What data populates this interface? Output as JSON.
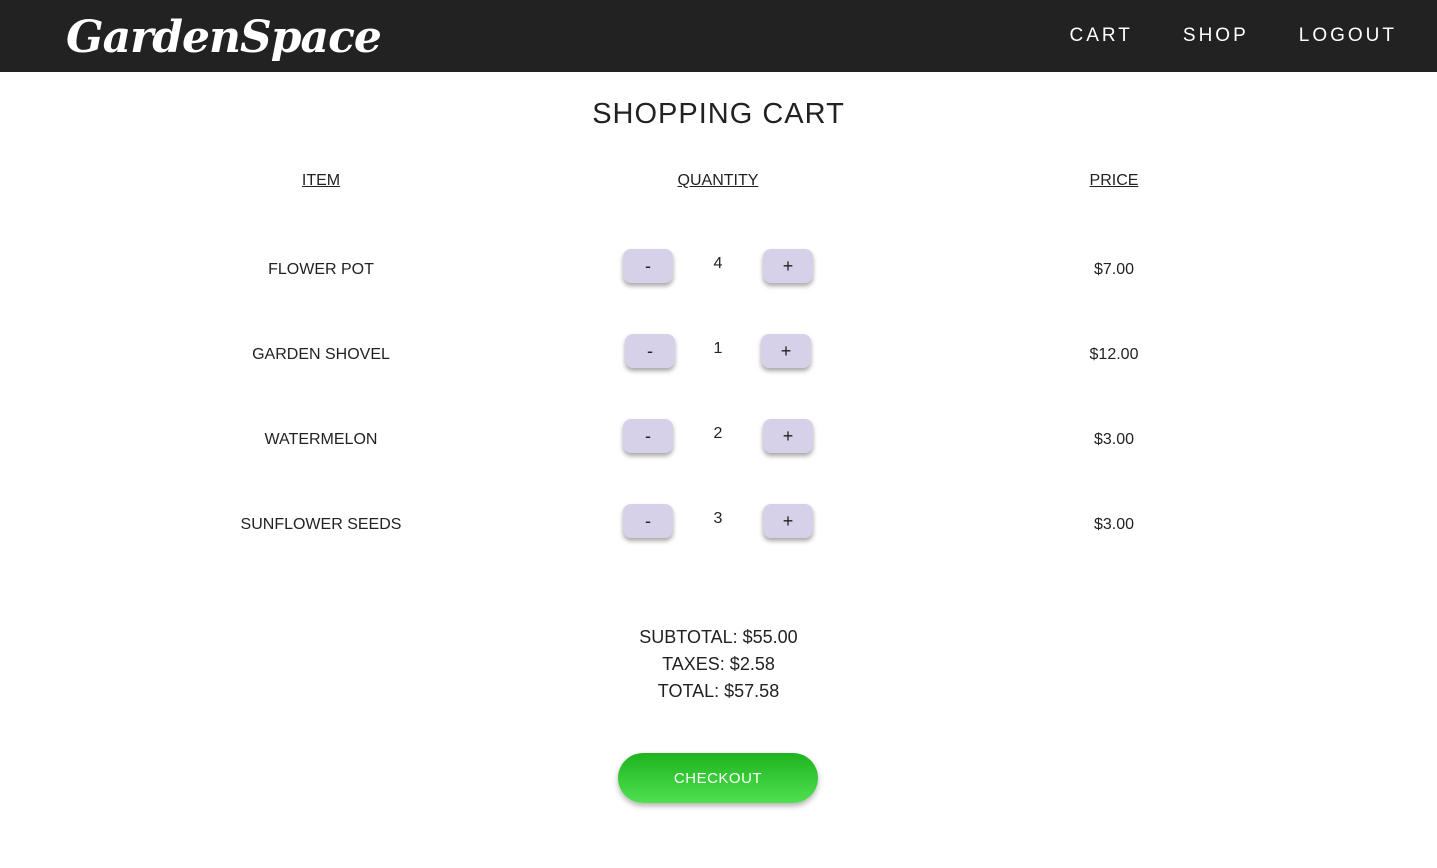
{
  "navbar": {
    "logo": "GardenSpace",
    "links": [
      "CART",
      "SHOP",
      "LOGOUT"
    ]
  },
  "page_title": "SHOPPING CART",
  "columns": {
    "item": "ITEM",
    "quantity": "QUANTITY",
    "price": "PRICE"
  },
  "rows": [
    {
      "item": "FLOWER POT",
      "quantity": "4",
      "price": "$7.00"
    },
    {
      "item": "GARDEN SHOVEL",
      "quantity": "1",
      "price": "$12.00"
    },
    {
      "item": "WATERMELON",
      "quantity": "2",
      "price": "$3.00"
    },
    {
      "item": "SUNFLOWER SEEDS",
      "quantity": "3",
      "price": "$3.00"
    }
  ],
  "buttons": {
    "minus": "-",
    "plus": "+",
    "checkout": "CHECKOUT"
  },
  "totals": {
    "subtotal": "SUBTOTAL: $55.00",
    "taxes": "TAXES: $2.58",
    "total": "TOTAL: $57.58"
  },
  "colors": {
    "navbar": "#222222",
    "qty_button": "#d6d0e8",
    "checkout_top": "#1fb31f",
    "checkout_bottom": "#4fe04f"
  }
}
